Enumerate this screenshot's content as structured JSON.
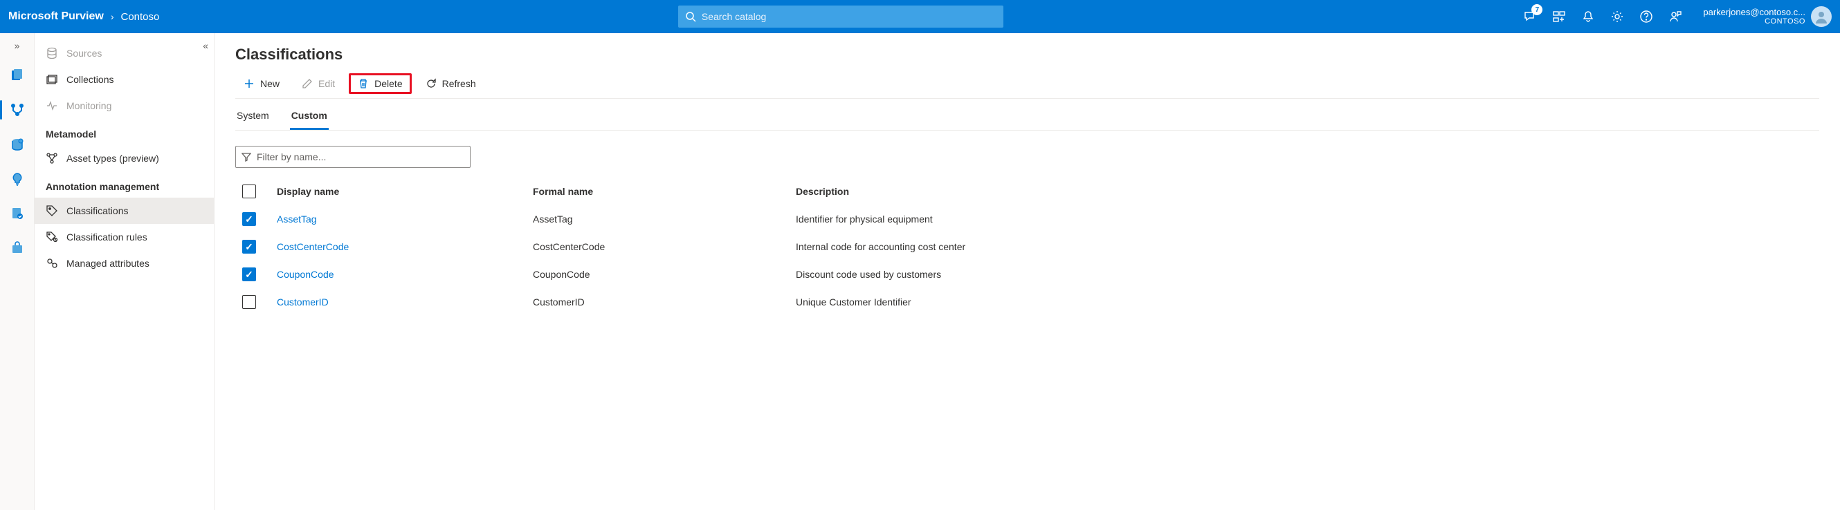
{
  "header": {
    "brand": "Microsoft Purview",
    "breadcrumb": "Contoso",
    "search_placeholder": "Search catalog",
    "notification_count": "7",
    "user_email": "parkerjones@contoso.c...",
    "user_org": "CONTOSO"
  },
  "sidebar": {
    "items": [
      {
        "label": "Sources",
        "disabled": true
      },
      {
        "label": "Collections",
        "disabled": false
      },
      {
        "label": "Monitoring",
        "disabled": true
      }
    ],
    "section_metamodel": "Metamodel",
    "asset_types": "Asset types (preview)",
    "section_annotation": "Annotation management",
    "annotation_items": [
      {
        "label": "Classifications",
        "selected": true
      },
      {
        "label": "Classification rules",
        "selected": false
      },
      {
        "label": "Managed attributes",
        "selected": false
      }
    ]
  },
  "main": {
    "title": "Classifications",
    "toolbar": {
      "new": "New",
      "edit": "Edit",
      "delete": "Delete",
      "refresh": "Refresh"
    },
    "tabs": {
      "system": "System",
      "custom": "Custom"
    },
    "filter_placeholder": "Filter by name...",
    "columns": {
      "display": "Display name",
      "formal": "Formal name",
      "description": "Description"
    },
    "rows": [
      {
        "checked": true,
        "display": "AssetTag",
        "formal": "AssetTag",
        "description": "Identifier for physical equipment"
      },
      {
        "checked": true,
        "display": "CostCenterCode",
        "formal": "CostCenterCode",
        "description": "Internal code for accounting cost center"
      },
      {
        "checked": true,
        "display": "CouponCode",
        "formal": "CouponCode",
        "description": "Discount code used by customers"
      },
      {
        "checked": false,
        "display": "CustomerID",
        "formal": "CustomerID",
        "description": "Unique Customer Identifier"
      }
    ]
  }
}
